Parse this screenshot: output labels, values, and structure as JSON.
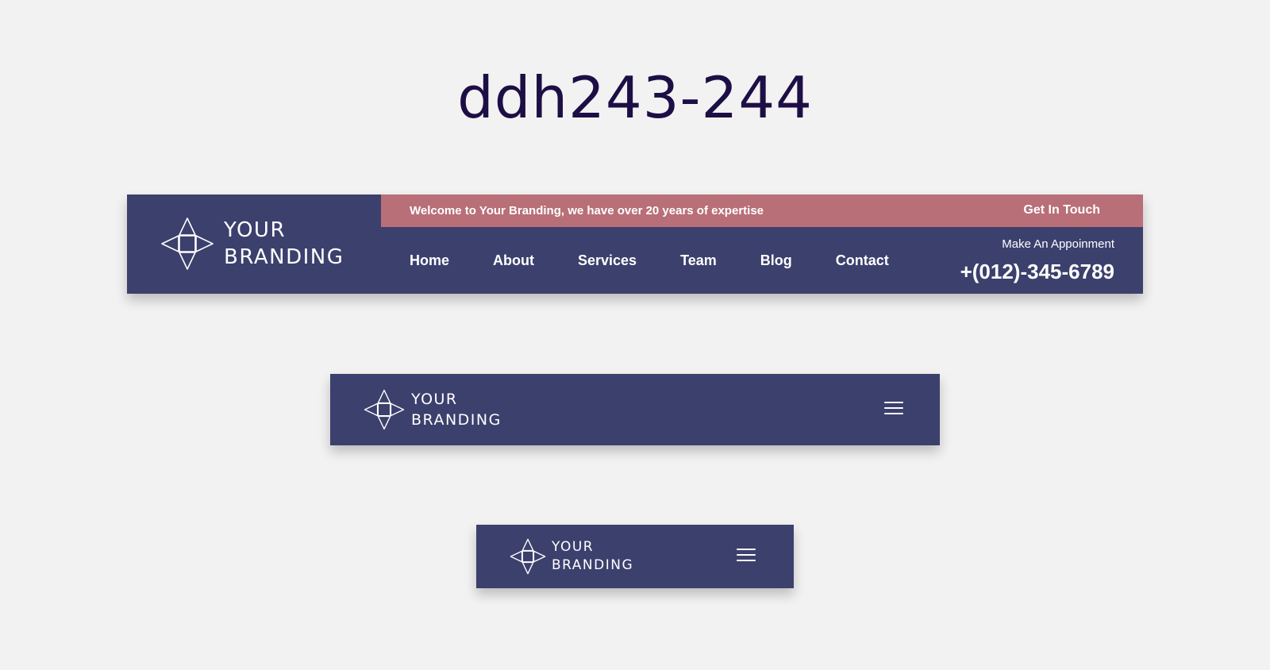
{
  "page": {
    "title": "ddh243-244"
  },
  "brand": {
    "line1": "YOUR",
    "line2": "BRANDING",
    "logo_icon": "diamond-arrows-icon"
  },
  "topbar": {
    "welcome": "Welcome to Your Branding, we have over 20 years of expertise",
    "cta_label": "Get In Touch"
  },
  "nav": {
    "items": [
      "Home",
      "About",
      "Services",
      "Team",
      "Blog",
      "Contact"
    ]
  },
  "contact": {
    "appointment_label": "Make An Appoinment",
    "phone": "+(012)-345-6789"
  },
  "mobile": {
    "menu_icon": "hamburger-menu-icon"
  },
  "colors": {
    "header_bg": "#3c406d",
    "topbar_bg": "#b86f78",
    "title": "#1d0f45",
    "page_bg": "#f2f2f2"
  }
}
